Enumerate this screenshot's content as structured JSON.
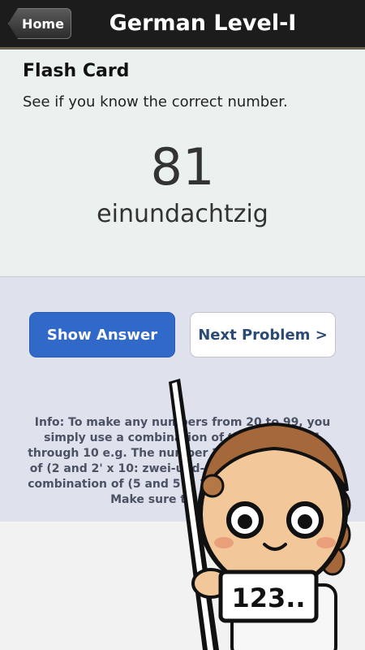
{
  "header": {
    "home_label": "Home",
    "title": "German Level-I"
  },
  "card": {
    "heading": "Flash Card",
    "subtitle": "See if you know the correct number.",
    "number": "81",
    "word": "einundachtzig"
  },
  "actions": {
    "show_answer": "Show Answer",
    "next_problem": "Next Problem >"
  },
  "info": {
    "text": "Info: To make any numbers from 20 to 99, you simply use a combination of the numbers 1 through 10 e.g. The number 22 is a combination of (2 and 2' x 10: zwei-und-zwanzig) and 55 is a combination of (5 and 5' x 10: fünf-und-fünfzig). Make sure to practice!"
  },
  "mascot": {
    "sign_text": "123.."
  }
}
